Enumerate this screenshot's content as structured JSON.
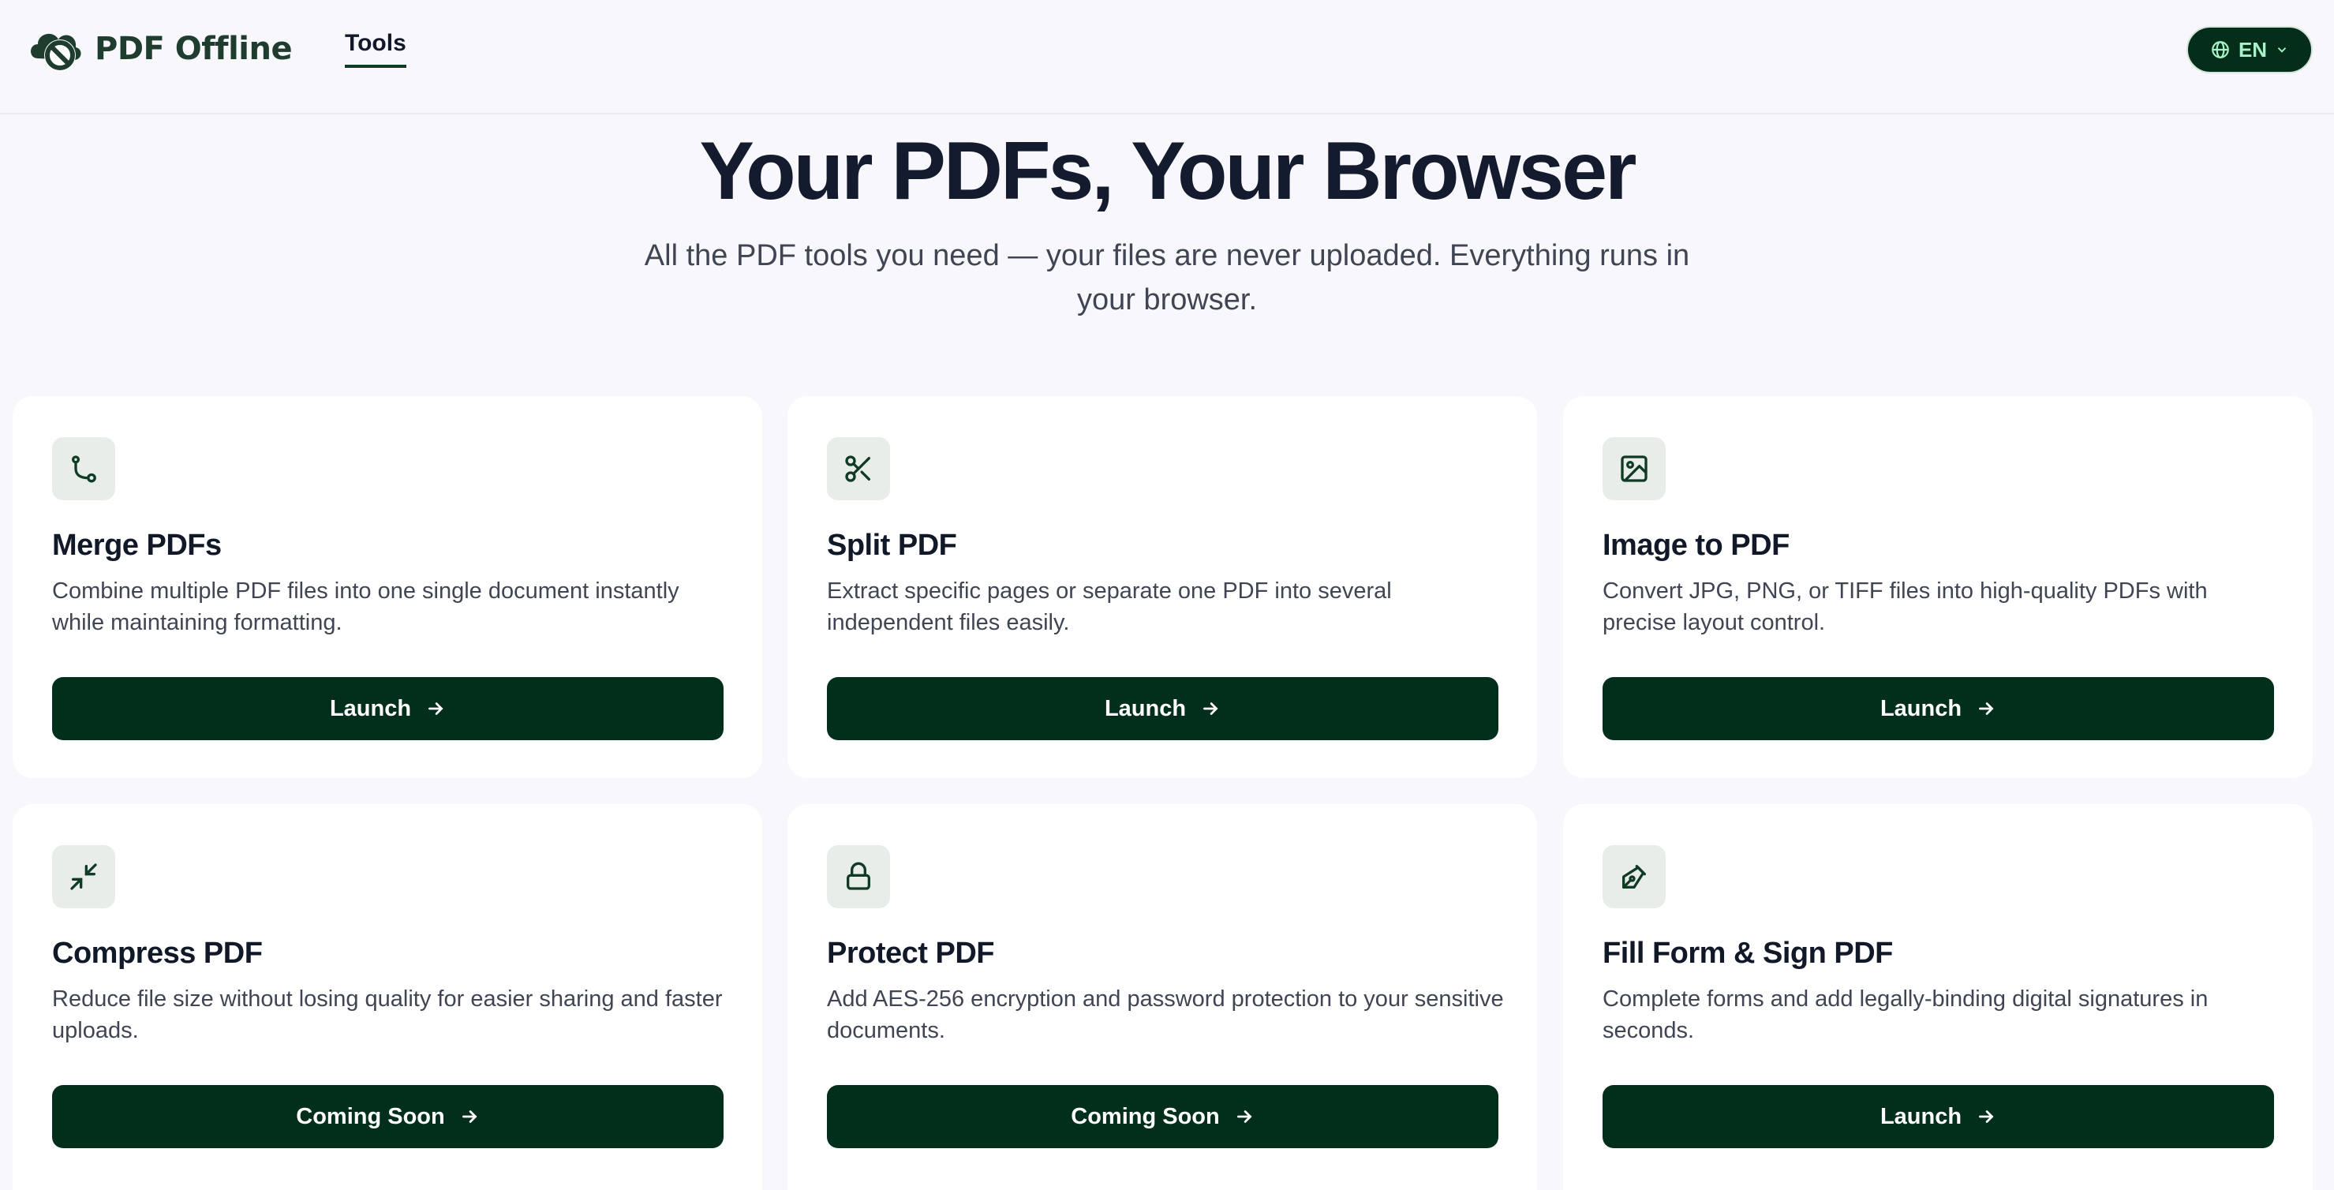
{
  "header": {
    "brand": "PDF Offline",
    "nav_tools": "Tools",
    "language": "EN"
  },
  "hero": {
    "title": "Your PDFs, Your Browser",
    "subtitle": "All the PDF tools you need — your files are never uploaded. Everything runs in your browser."
  },
  "tools": [
    {
      "title": "Merge PDFs",
      "description": "Combine multiple PDF files into one single document instantly while maintaining formatting.",
      "button": "Launch",
      "icon": "merge-icon"
    },
    {
      "title": "Split PDF",
      "description": "Extract specific pages or separate one PDF into several independent files easily.",
      "button": "Launch",
      "icon": "scissors-icon"
    },
    {
      "title": "Image to PDF",
      "description": "Convert JPG, PNG, or TIFF files into high-quality PDFs with precise layout control.",
      "button": "Launch",
      "icon": "image-icon"
    },
    {
      "title": "Compress PDF",
      "description": "Reduce file size without losing quality for easier sharing and faster uploads.",
      "button": "Coming Soon",
      "icon": "compress-icon"
    },
    {
      "title": "Protect PDF",
      "description": "Add AES-256 encryption and password protection to your sensitive documents.",
      "button": "Coming Soon",
      "icon": "lock-icon"
    },
    {
      "title": "Fill Form & Sign PDF",
      "description": "Complete forms and add legally-binding digital signatures in seconds.",
      "button": "Launch",
      "icon": "pen-icon"
    }
  ],
  "colors": {
    "brand_green": "#1f3d2e",
    "button_dark": "#022e1c",
    "icon_bg": "#e8edea",
    "page_bg": "#f8f8fc"
  }
}
